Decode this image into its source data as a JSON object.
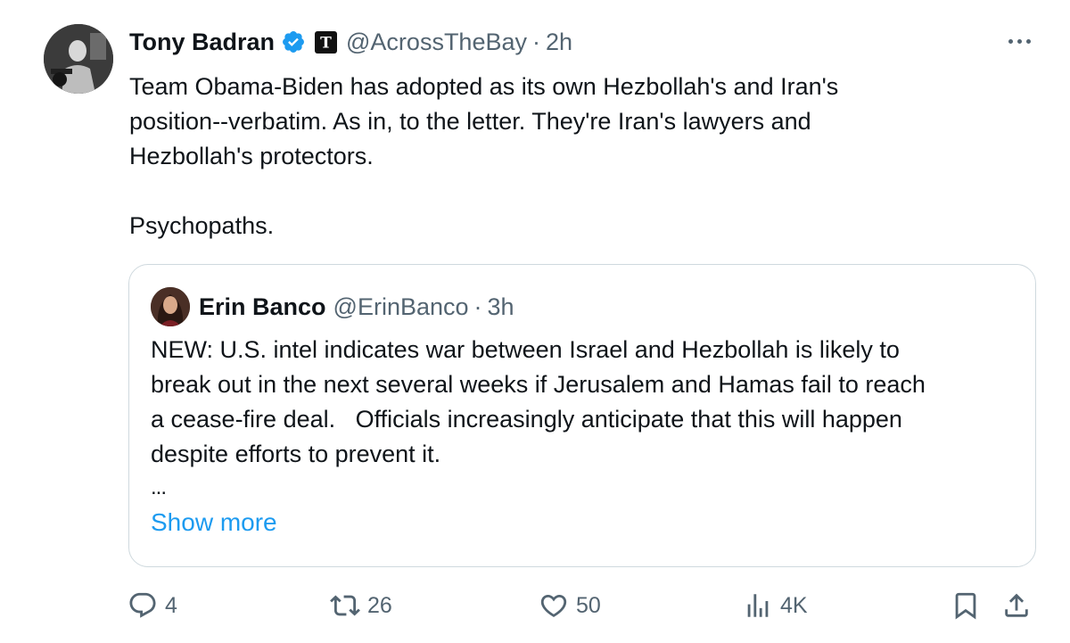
{
  "tweet": {
    "author": {
      "display_name": "Tony Badran",
      "handle": "@AcrossTheBay",
      "time": "2h",
      "separator": "·",
      "verified_badge_color": "#1d9bf0",
      "affiliation_badge_letter": "T"
    },
    "text": "Team Obama-Biden has adopted as its own Hezbollah's and Iran's\nposition--verbatim. As in, to the letter. They're Iran's lawyers and\nHezbollah's protectors.\n\nPsychopaths.",
    "quote": {
      "display_name": "Erin Banco",
      "handle": "@ErinBanco",
      "separator": "·",
      "time": "3h",
      "text": "NEW: U.S. intel indicates war between Israel and Hezbollah is likely to\nbreak out in the next several weeks if Jerusalem and Hamas fail to reach\na cease-fire deal.   Officials increasingly anticipate that this will happen\ndespite efforts to prevent it.",
      "ellipsis": "...",
      "show_more": "Show more"
    },
    "actions": {
      "replies": "4",
      "reposts": "26",
      "likes": "50",
      "views": "4K"
    }
  },
  "colors": {
    "text_primary": "#0f1419",
    "text_secondary": "#536471",
    "link": "#1d9bf0",
    "border": "#cfd9de"
  },
  "icons": [
    "verified-badge-icon",
    "affiliation-badge-icon",
    "more-icon",
    "reply-icon",
    "repost-icon",
    "like-icon",
    "views-icon",
    "bookmark-icon",
    "share-icon"
  ]
}
